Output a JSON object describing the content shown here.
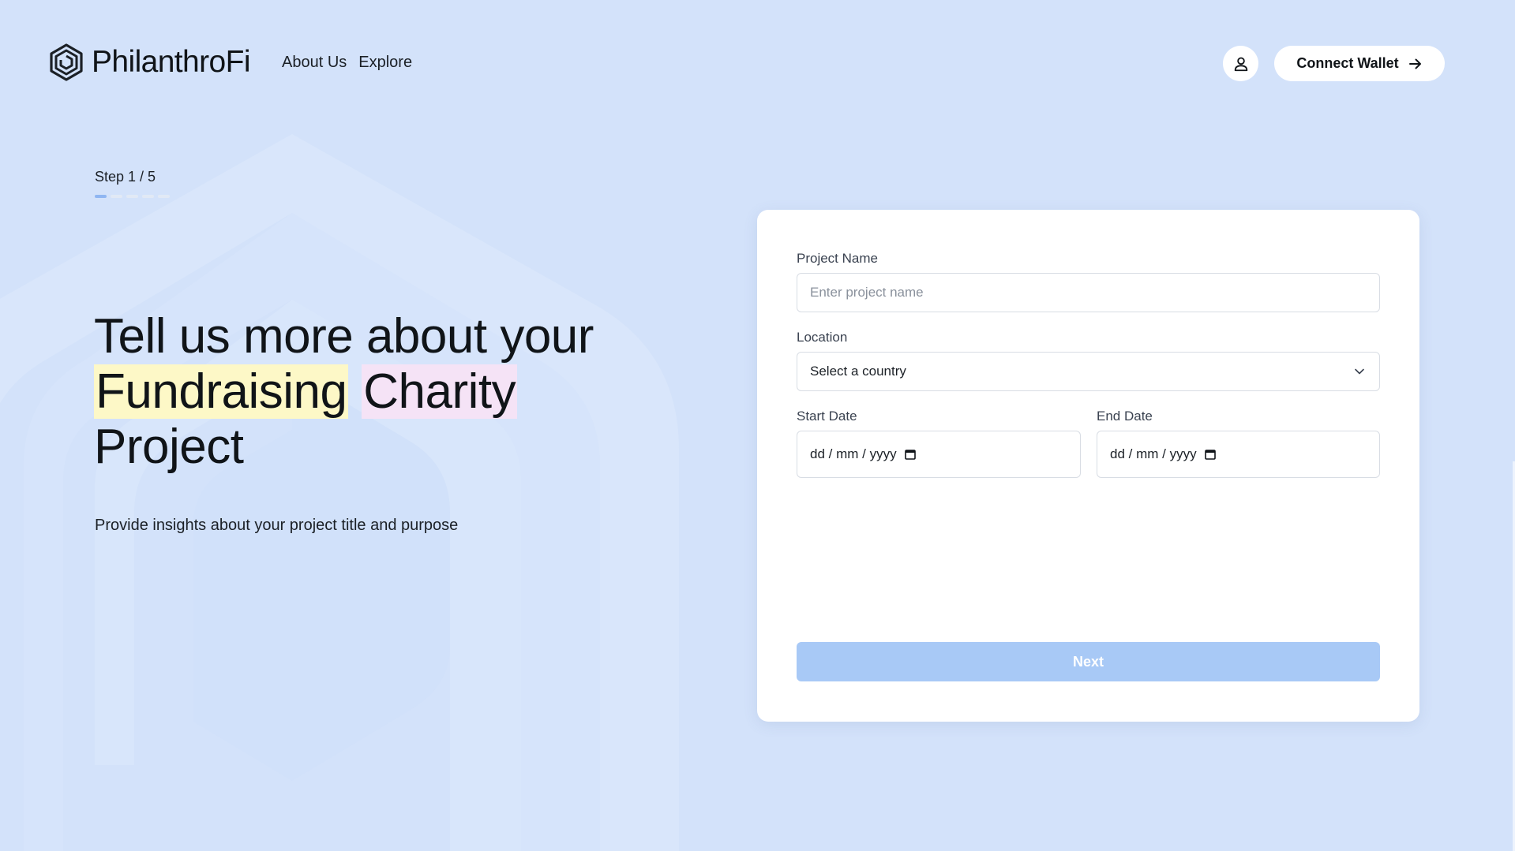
{
  "brand": {
    "name": "PhilanthroFi",
    "icon": "hexagon-spiral-logo-icon"
  },
  "nav": {
    "items": [
      {
        "label": "About Us"
      },
      {
        "label": "Explore"
      }
    ]
  },
  "header": {
    "profile_icon": "user-icon",
    "connect_wallet": {
      "label": "Connect Wallet",
      "icon": "arrow-right-icon"
    }
  },
  "step": {
    "label": "Step 1 / 5",
    "current": 1,
    "total": 5
  },
  "hero": {
    "title_line1": "Tell us more about your",
    "highlight1": "Fundraising",
    "highlight2": "Charity",
    "title_line3": "Project",
    "subtitle": "Provide insights about your project title and purpose"
  },
  "form": {
    "project_name": {
      "label": "Project Name",
      "placeholder": "Enter project name",
      "value": ""
    },
    "location": {
      "label": "Location",
      "selected": "Select a country",
      "icon": "chevron-down-icon"
    },
    "start_date": {
      "label": "Start Date",
      "value": "dd / mm / yyyy",
      "icon": "calendar-icon"
    },
    "end_date": {
      "label": "End Date",
      "value": "dd / mm / yyyy",
      "icon": "calendar-icon"
    },
    "next_button": {
      "label": "Next"
    }
  },
  "colors": {
    "background": "#d3e2fa",
    "highlight_yellow": "#fdf8c7",
    "highlight_pink": "#f5e3f6",
    "next_button": "#a8c9f6",
    "step_active": "#8fb6f2"
  }
}
